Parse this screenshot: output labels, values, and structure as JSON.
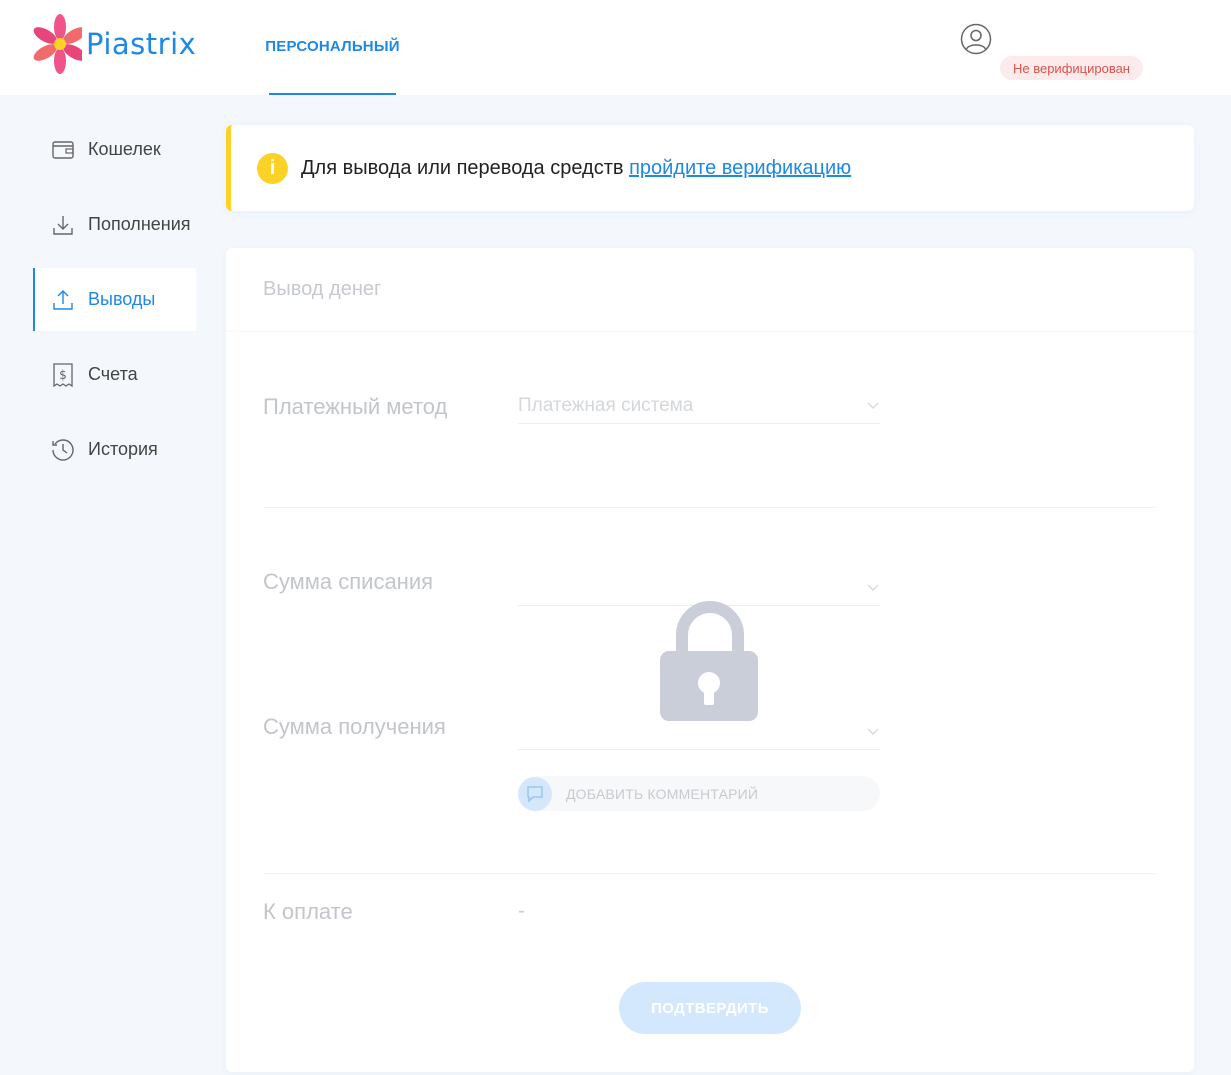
{
  "brand": {
    "name": "Piastrix"
  },
  "header": {
    "tab_personal": "ПЕРСОНАЛЬНЫЙ",
    "status_badge": "Не верифицирован"
  },
  "sidebar": {
    "items": [
      {
        "label": "Кошелек",
        "icon": "wallet-icon"
      },
      {
        "label": "Пополнения",
        "icon": "download-icon"
      },
      {
        "label": "Выводы",
        "icon": "upload-icon",
        "active": true
      },
      {
        "label": "Счета",
        "icon": "invoice-icon"
      },
      {
        "label": "История",
        "icon": "history-icon"
      }
    ]
  },
  "alert": {
    "text": "Для вывода или перевода средств ",
    "link": "пройдите верификацию"
  },
  "withdraw": {
    "title": "Вывод денег",
    "payment_method_label": "Платежный метод",
    "payment_system_placeholder": "Платежная система",
    "debit_amount_label": "Сумма списания",
    "receive_amount_label": "Сумма получения",
    "add_comment": "ДОБАВИТЬ КОММЕНТАРИЙ",
    "to_pay_label": "К оплате",
    "to_pay_value": "-",
    "confirm_button": "ПОДТВЕРДИТЬ"
  },
  "colors": {
    "accent": "#1e88e5",
    "warning": "#fcd226",
    "badge_text": "#d9534f",
    "badge_bg": "#fdeaea",
    "lock": "#c9ced8"
  }
}
